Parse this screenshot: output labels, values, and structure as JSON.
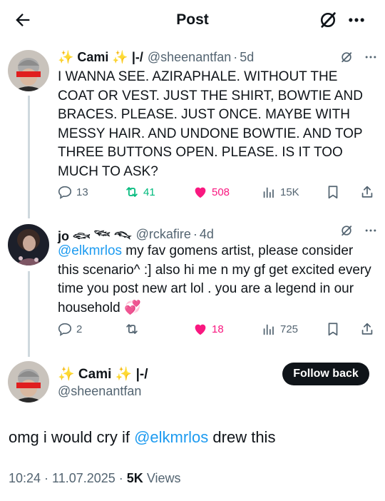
{
  "header": {
    "title": "Post"
  },
  "tweets": [
    {
      "name": "✨ Cami ✨ |-/",
      "handle": "@sheenantfan",
      "time": "5d",
      "text": "I WANNA SEE. AZIRAPHALE. WITHOUT THE COAT OR VEST. JUST THE SHIRT, BOWTIE AND BRACES. PLEASE. JUST ONCE. MAYBE WITH MESSY HAIR. AND UNDONE BOWTIE. AND TOP THREE BUTTONS OPEN. PLEASE. IS IT TOO MUCH TO ASK?",
      "replies": "13",
      "reposts": "41",
      "likes": "508",
      "views": "15K"
    },
    {
      "name": "jo 𓆟 𓆝 𓆞",
      "handle": "@rckafire",
      "time": "4d",
      "mention": "@elkmrlos",
      "text": " my fav gomens artist, please consider  this scenario^   :]   also hi me n my gf get excited every time you post new art lol . you are a legend in our household 💞",
      "replies": "2",
      "reposts": "",
      "likes": "18",
      "views": "725"
    }
  ],
  "main": {
    "name": "✨ Cami ✨ |-/",
    "handle": "@sheenantfan",
    "follow_label": "Follow back",
    "text_before": "omg i would cry if ",
    "mention": "@elkmrlos",
    "text_after": " drew this",
    "timestamp": "10:24 · 11.07.2025 · ",
    "views_count": "5K",
    "views_label": " Views"
  },
  "colors": {
    "accent": "#1d9bf0",
    "like": "#f91880",
    "repost": "#00ba7c",
    "muted": "#536471"
  }
}
